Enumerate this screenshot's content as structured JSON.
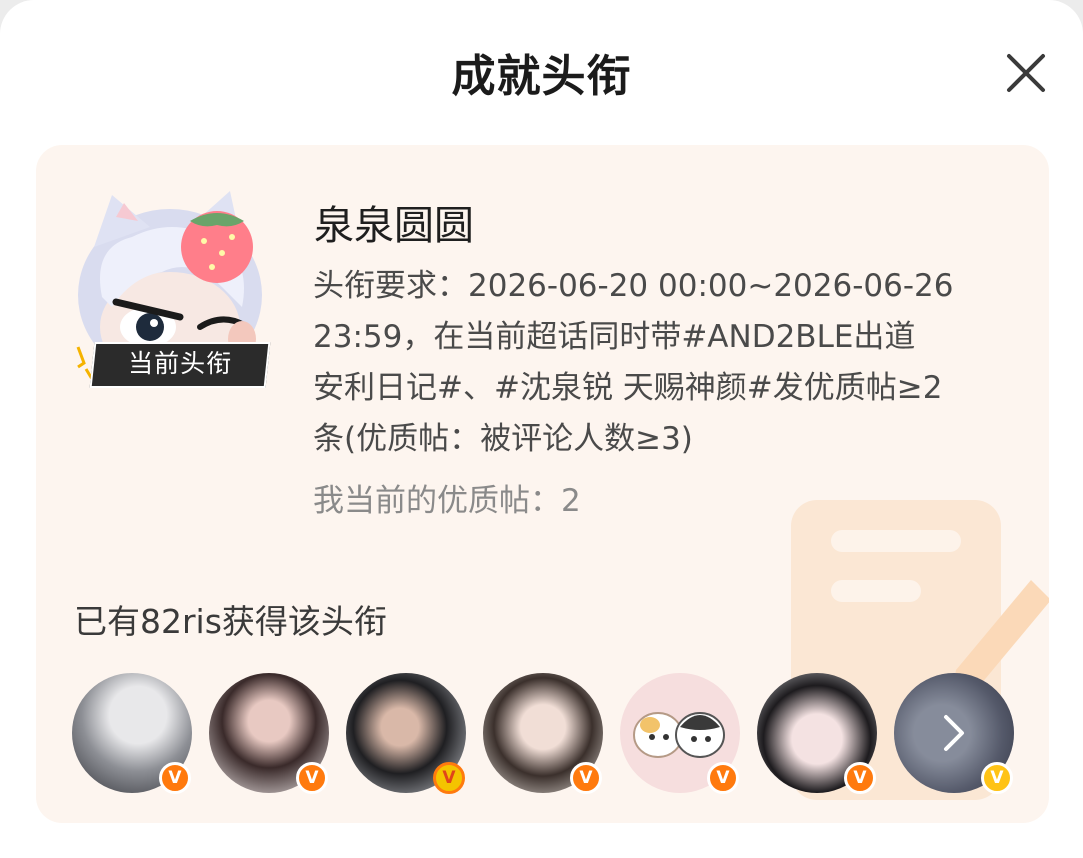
{
  "header": {
    "title": "成就头衔"
  },
  "badge": {
    "current_label": "当前头衔"
  },
  "title_info": {
    "name": "泉泉圆圆",
    "requirement_lines": [
      "头衔要求：2026-06-20 00:00~2026-06-26",
      "23:59，在当前超话同时带#AND2BLE出道",
      "安利日记#、#沈泉锐 天赐神颜#发优质帖≥2",
      "条(优质帖：被评论人数≥3)"
    ],
    "current_progress": "我当前的优质帖：2"
  },
  "owners": {
    "summary": "已有82ris获得该头衔",
    "avatars": [
      {
        "verified": "orange"
      },
      {
        "verified": "orange"
      },
      {
        "verified": "orange"
      },
      {
        "verified": "orange"
      },
      {
        "verified": "orange"
      },
      {
        "verified": "orange"
      },
      {
        "verified": "gold"
      }
    ]
  },
  "colors": {
    "card_bg": "#fdf5ef",
    "accent_orange": "#ff7a0e",
    "gold": "#ffc316"
  },
  "icons": [
    "close-icon",
    "chevron-right-icon",
    "verified-v-icon",
    "document-pencil-icon"
  ]
}
